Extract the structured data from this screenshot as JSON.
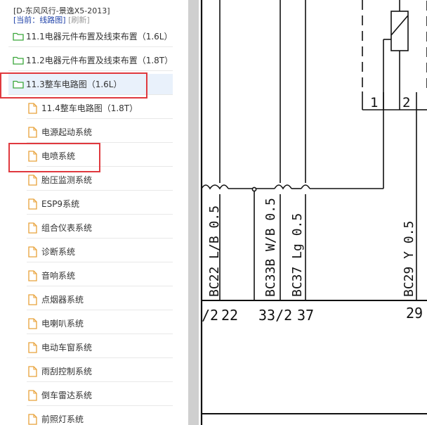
{
  "header": {
    "title": "[D-东风风行-景逸X5-2013]",
    "current_prefix": "[当前：线路图]",
    "refresh_label": "[刷新]"
  },
  "tree": [
    {
      "type": "folder",
      "label": "11.1电器元件布置及线束布置（1.6L）",
      "selected": false
    },
    {
      "type": "folder",
      "label": "11.2电器元件布置及线束布置（1.8T）",
      "selected": false
    },
    {
      "type": "folder",
      "label": "11.3整车电路图（1.6L）",
      "selected": true
    },
    {
      "type": "file",
      "label": "11.4整车电路图（1.8T）"
    },
    {
      "type": "file",
      "label": "电源起动系统"
    },
    {
      "type": "file",
      "label": "电喷系统"
    },
    {
      "type": "file",
      "label": "胎压监测系统"
    },
    {
      "type": "file",
      "label": "ESP9系统"
    },
    {
      "type": "file",
      "label": "组合仪表系统"
    },
    {
      "type": "file",
      "label": "诊断系统"
    },
    {
      "type": "file",
      "label": "音响系统"
    },
    {
      "type": "file",
      "label": "点烟器系统"
    },
    {
      "type": "file",
      "label": "电喇叭系统"
    },
    {
      "type": "file",
      "label": "电动车窗系统"
    },
    {
      "type": "file",
      "label": "雨刮控制系统"
    },
    {
      "type": "file",
      "label": "倒车雷达系统"
    },
    {
      "type": "file",
      "label": "前照灯系统"
    }
  ],
  "colors": {
    "highlight": "#e0393e",
    "folder_icon": "#3aa63a",
    "file_icon": "#e8a23a",
    "selected_bg": "#e9f1fb"
  },
  "diagram": {
    "pin_1": "1",
    "pin_2": "2",
    "wire_labels": [
      "BC22 L/B 0.5",
      "BC33B W/B 0.5",
      "BC37 Lg 0.5",
      "BC29 Y 0.5"
    ],
    "terminals": [
      "/2",
      "22",
      "33/2",
      "37",
      "29"
    ]
  }
}
